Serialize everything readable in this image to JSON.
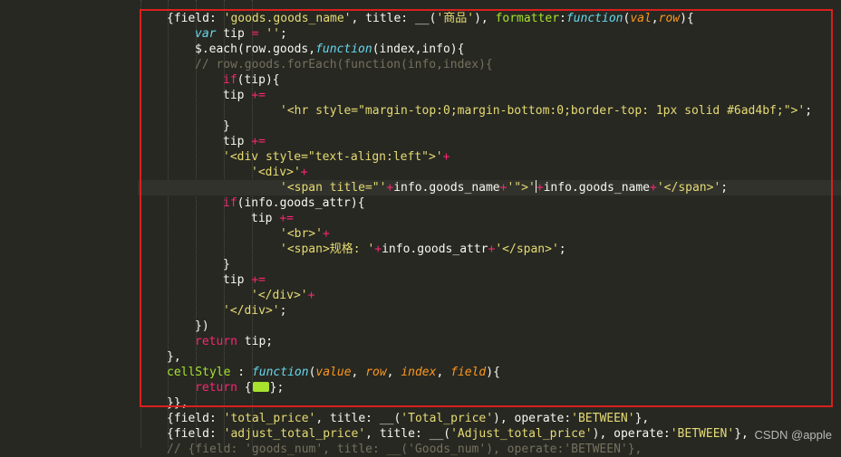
{
  "code_lines": [
    [
      [
        "c-white",
        "{field: "
      ],
      [
        "c-str",
        "'goods.goods_name'"
      ],
      [
        "c-white",
        ", title: __("
      ],
      [
        "c-str",
        "'商品'"
      ],
      [
        "c-white",
        "), "
      ],
      [
        "c-fn",
        "formatter"
      ],
      [
        "c-white",
        ":"
      ],
      [
        "c-blue",
        "function"
      ],
      [
        "c-white",
        "("
      ],
      [
        "c-param",
        "val"
      ],
      [
        "c-white",
        ","
      ],
      [
        "c-param",
        "row"
      ],
      [
        "c-white",
        "){"
      ]
    ],
    [
      [
        "c-blue",
        "var"
      ],
      [
        "c-white",
        " tip "
      ],
      [
        "c-kw",
        "="
      ],
      [
        "c-white",
        " "
      ],
      [
        "c-str",
        "''"
      ],
      [
        "c-white",
        ";"
      ]
    ],
    [
      [
        "c-white",
        "$.each(row.goods,"
      ],
      [
        "c-blue",
        "function"
      ],
      [
        "c-white",
        "(index,info){"
      ]
    ],
    [
      [
        "c-comment",
        "// row.goods.forEach(function(info,index){"
      ]
    ],
    [
      [
        "c-kw",
        "if"
      ],
      [
        "c-white",
        "(tip){"
      ]
    ],
    [
      [
        "c-white",
        "tip "
      ],
      [
        "c-kw",
        "+="
      ]
    ],
    [
      [
        "c-str",
        "'<hr style=\"margin-top:0;margin-bottom:0;border-top: 1px solid #6ad4bf;\">'"
      ],
      [
        "c-white",
        ";"
      ]
    ],
    [
      [
        "c-white",
        "}"
      ]
    ],
    [
      [
        "c-white",
        "tip "
      ],
      [
        "c-kw",
        "+="
      ]
    ],
    [
      [
        "c-str",
        "'<div style=\"text-align:left\">'"
      ],
      [
        "c-kw",
        "+"
      ]
    ],
    [
      [
        "c-str",
        "'<div>'"
      ],
      [
        "c-kw",
        "+"
      ]
    ],
    [
      [
        "c-str",
        "'<span title=\"'"
      ],
      [
        "c-kw",
        "+"
      ],
      [
        "c-white",
        "info.goods_name"
      ],
      [
        "c-kw",
        "+"
      ],
      [
        "c-str",
        "'\">'"
      ],
      [
        "c-kw",
        "+"
      ],
      [
        "c-white",
        "info.goods_name"
      ],
      [
        "c-kw",
        "+"
      ],
      [
        "c-str",
        "'</span>'"
      ],
      [
        "c-white",
        ";"
      ]
    ],
    [
      [
        "c-kw",
        "if"
      ],
      [
        "c-white",
        "(info.goods_attr){"
      ]
    ],
    [
      [
        "c-white",
        "tip "
      ],
      [
        "c-kw",
        "+="
      ]
    ],
    [
      [
        "c-str",
        "'<br>'"
      ],
      [
        "c-kw",
        "+"
      ]
    ],
    [
      [
        "c-str",
        "'<span>规格: '"
      ],
      [
        "c-kw",
        "+"
      ],
      [
        "c-white",
        "info.goods_attr"
      ],
      [
        "c-kw",
        "+"
      ],
      [
        "c-str",
        "'</span>'"
      ],
      [
        "c-white",
        ";"
      ]
    ],
    [
      [
        "c-white",
        "}"
      ]
    ],
    [
      [
        "c-white",
        "tip "
      ],
      [
        "c-kw",
        "+="
      ]
    ],
    [
      [
        "c-str",
        "'</div>'"
      ],
      [
        "c-kw",
        "+"
      ]
    ],
    [
      [
        "c-str",
        "'</div>'"
      ],
      [
        "c-white",
        ";"
      ]
    ],
    [
      [
        "c-white",
        "})"
      ]
    ],
    [
      [
        "c-kw",
        "return"
      ],
      [
        "c-white",
        " tip;"
      ]
    ],
    [
      [
        "c-white",
        "},"
      ]
    ],
    [
      [
        "c-fn",
        "cellStyle"
      ],
      [
        "c-white",
        " : "
      ],
      [
        "c-blue",
        "function"
      ],
      [
        "c-white",
        "("
      ],
      [
        "c-param",
        "value"
      ],
      [
        "c-white",
        ", "
      ],
      [
        "c-param",
        "row"
      ],
      [
        "c-white",
        ", "
      ],
      [
        "c-param",
        "index"
      ],
      [
        "c-white",
        ", "
      ],
      [
        "c-param",
        "field"
      ],
      [
        "c-white",
        "){"
      ]
    ],
    [
      [
        "c-kw",
        "return"
      ],
      [
        "c-white",
        " {"
      ],
      [
        "emoji",
        ""
      ],
      [
        "c-white",
        "};"
      ]
    ],
    [
      [
        "c-white",
        "}},"
      ]
    ],
    [
      [
        "c-white",
        "{field: "
      ],
      [
        "c-str",
        "'total_price'"
      ],
      [
        "c-white",
        ", title: __("
      ],
      [
        "c-str",
        "'Total_price'"
      ],
      [
        "c-white",
        "), operate:"
      ],
      [
        "c-str",
        "'BETWEEN'"
      ],
      [
        "c-white",
        "},"
      ]
    ],
    [
      [
        "c-white",
        "{field: "
      ],
      [
        "c-str",
        "'adjust_total_price'"
      ],
      [
        "c-white",
        ", title: __("
      ],
      [
        "c-str",
        "'Adjust_total_price'"
      ],
      [
        "c-white",
        "), operate:"
      ],
      [
        "c-str",
        "'BETWEEN'"
      ],
      [
        "c-white",
        "},"
      ]
    ],
    [
      [
        "c-comment",
        "// {field: 'goods_num', title: __('Goods_num'), operate:'BETWEEN'},"
      ]
    ]
  ],
  "watermark": "CSDN @apple"
}
